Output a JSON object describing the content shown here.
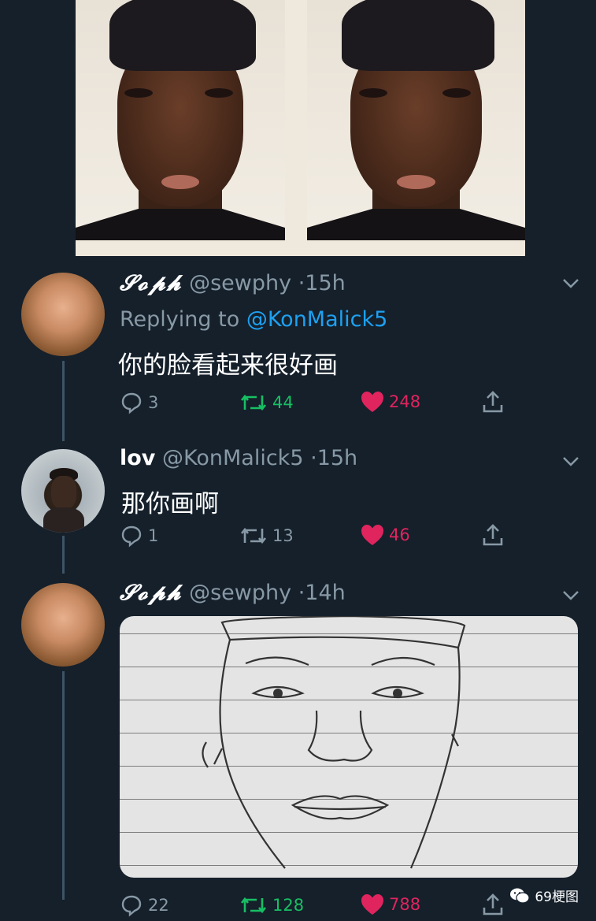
{
  "tweets": [
    {
      "display_name": "𝓢𝓸𝓹𝓱",
      "handle": "@sewphy",
      "separator": "·",
      "time": "15h",
      "replying_prefix": "Replying to ",
      "replying_to": "@KonMalick5",
      "text": "你的脸看起来很好画",
      "replies": "3",
      "retweets": "44",
      "likes": "248"
    },
    {
      "display_name": "lov",
      "handle": "@KonMalick5",
      "separator": "·",
      "time": "15h",
      "text": "那你画啊",
      "replies": "1",
      "retweets": "13",
      "likes": "46"
    },
    {
      "display_name": "𝓢𝓸𝓹𝓱",
      "handle": "@sewphy",
      "separator": "·",
      "time": "14h",
      "replies": "22",
      "retweets": "128",
      "likes": "788"
    }
  ],
  "watermark": "69梗图",
  "colors": {
    "background": "#15202b",
    "muted": "#8899a6",
    "link": "#1da1f2",
    "retweet": "#17bf63",
    "like": "#e0245e"
  },
  "icons": [
    "reply-icon",
    "retweet-icon",
    "heart-icon",
    "share-icon",
    "chevron-down-icon",
    "wechat-icon"
  ]
}
